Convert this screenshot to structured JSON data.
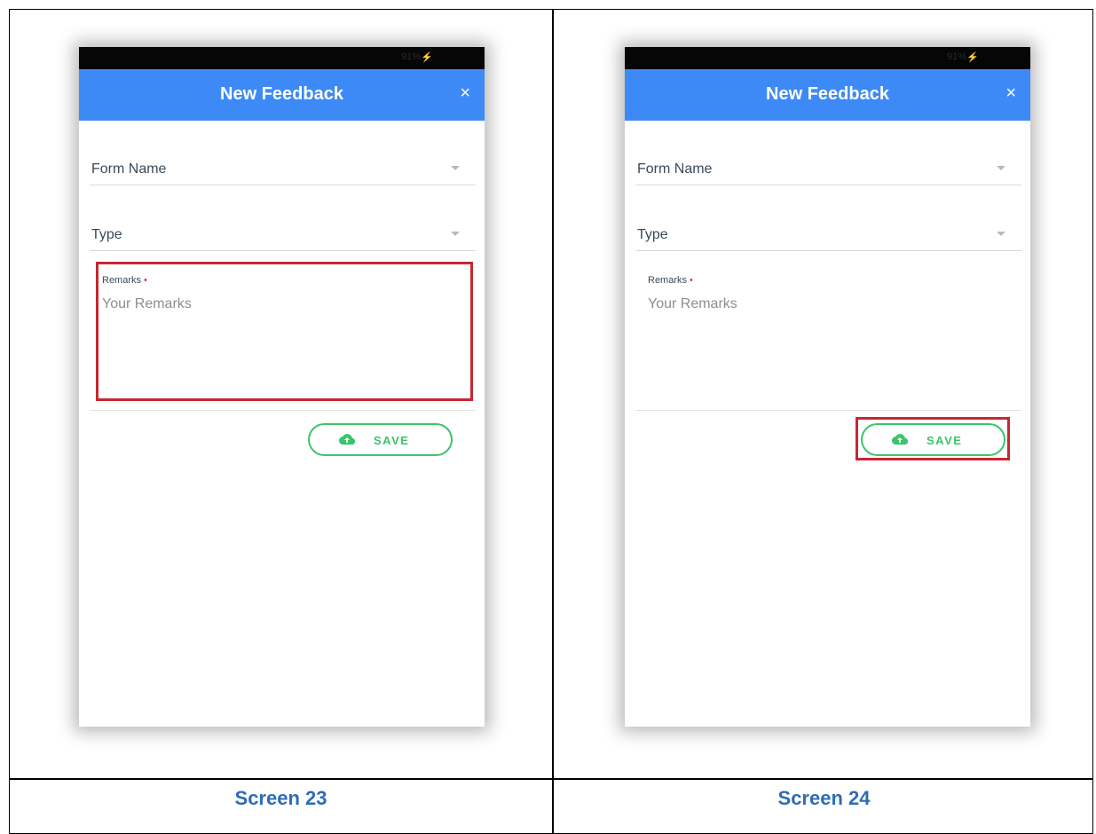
{
  "screens": [
    {
      "status": {
        "battery": "91%"
      },
      "appbar": {
        "title": "New Feedback",
        "close_symbol": "×"
      },
      "form": {
        "form_name_label": "Form Name",
        "type_label": "Type",
        "remarks_label": "Remarks",
        "remarks_required_mark": "•",
        "remarks_placeholder": "Your Remarks",
        "save_label": "SAVE"
      },
      "highlighted": "remarks-field",
      "caption": "Screen 23"
    },
    {
      "status": {
        "battery": "91%"
      },
      "appbar": {
        "title": "New Feedback",
        "close_symbol": "×"
      },
      "form": {
        "form_name_label": "Form Name",
        "type_label": "Type",
        "remarks_label": "Remarks",
        "remarks_required_mark": "•",
        "remarks_placeholder": "Your Remarks",
        "save_label": "SAVE"
      },
      "highlighted": "save-button",
      "caption": "Screen 24"
    }
  ],
  "colors": {
    "appbar": "#3d8af7",
    "save_accent": "#3cc46a",
    "highlight": "#c62832",
    "caption": "#2e6db5",
    "required": "#e53935"
  },
  "icons": {
    "close": "close-icon",
    "dropdown": "caret-icon",
    "save": "cloud-upload-icon",
    "status": "bolt-icon"
  }
}
